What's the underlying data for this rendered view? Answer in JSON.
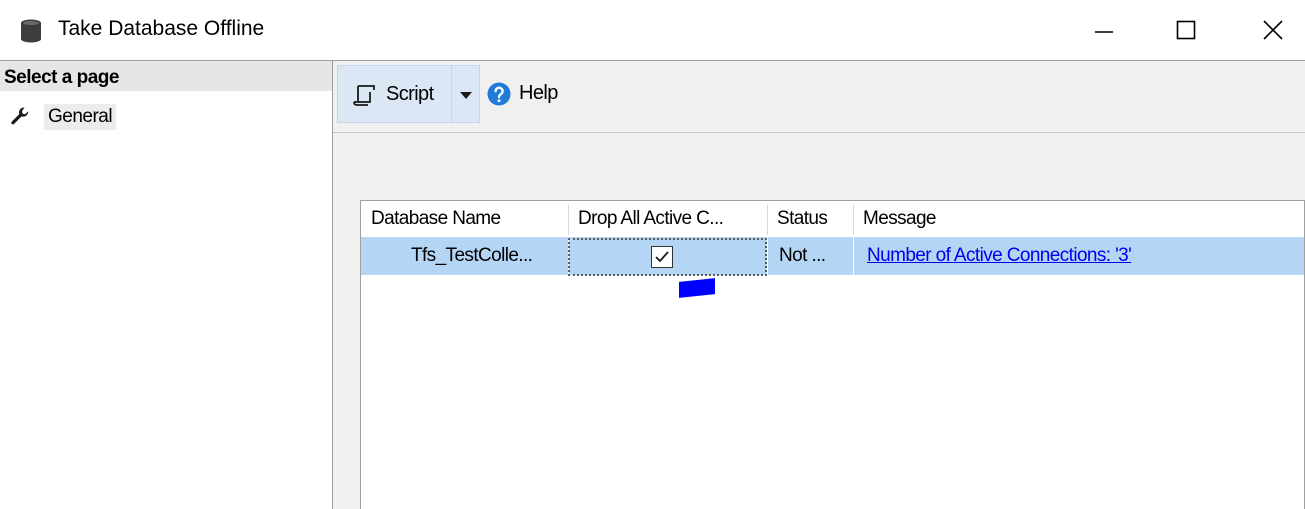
{
  "window": {
    "title": "Take Database Offline",
    "icon": "database-icon",
    "controls": [
      "minimize-icon",
      "maximize-icon",
      "close-icon"
    ]
  },
  "left_panel": {
    "header": "Select a page",
    "items": [
      {
        "label": "General",
        "icon": "wrench-icon"
      }
    ]
  },
  "toolbar": {
    "script_label": "Script",
    "help_label": "Help"
  },
  "grid": {
    "columns": [
      "Database Name",
      "Drop All Active C...",
      "Status",
      "Message"
    ],
    "rows": [
      {
        "database_name": "Tfs_TestColle...",
        "drop_all_active_connections": true,
        "status": "Not ...",
        "message": "Number of Active Connections: '3'"
      }
    ]
  },
  "colors": {
    "selection": "#b5d5f5",
    "toolbar_button": "#dbe7f5",
    "link": "#0000ee",
    "help_icon": "#1e7bd8"
  }
}
